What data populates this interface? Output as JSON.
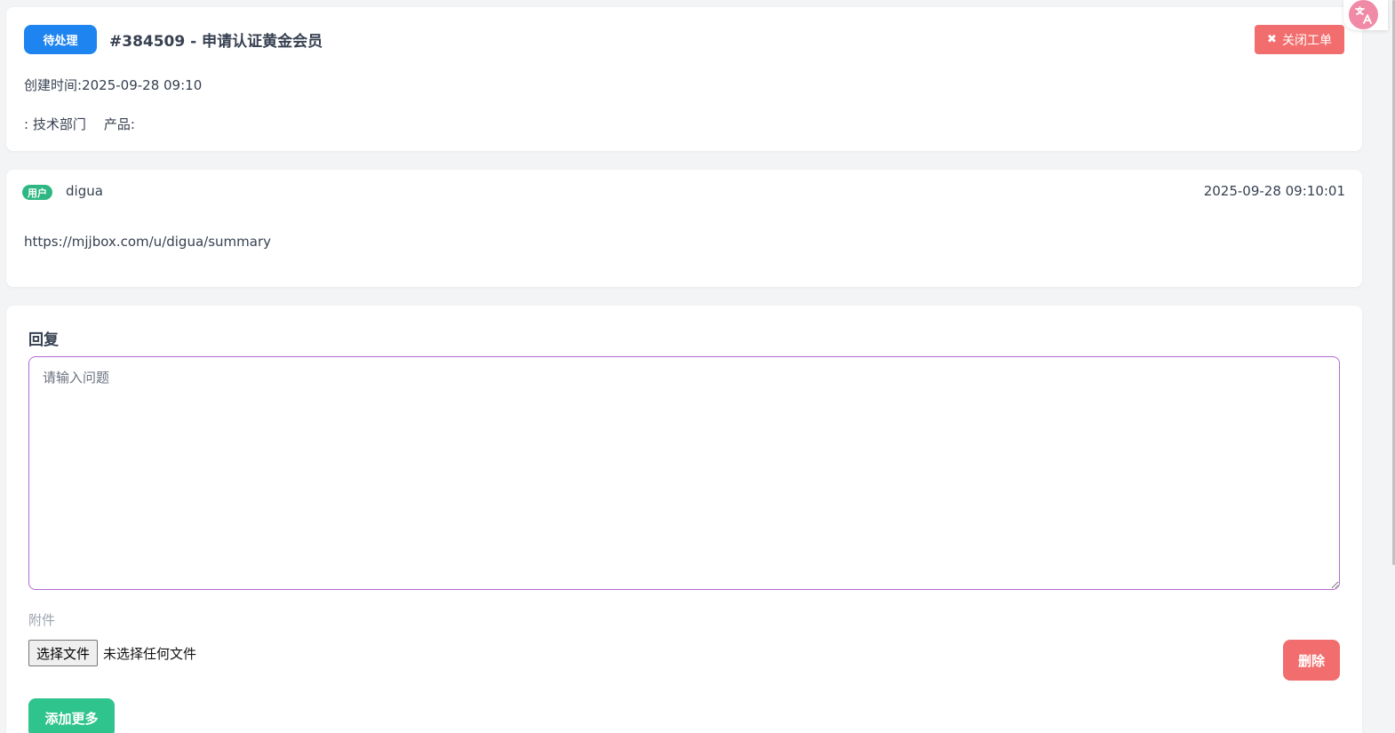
{
  "ticket": {
    "status": "待处理",
    "title": "#384509 - 申请认证黄金会员",
    "close_button": "关闭工单",
    "created_label": "创建时间:",
    "created_value": "2025-09-28 09:10",
    "department_label": ":",
    "department_value": "技术部门",
    "product_label": "产品:",
    "product_value": ""
  },
  "message": {
    "role_badge": "用户",
    "username": "digua",
    "timestamp": "2025-09-28 09:10:01",
    "content": "https://mjjbox.com/u/digua/summary"
  },
  "reply": {
    "heading": "回复",
    "placeholder": "请输入问题",
    "value": "",
    "attachment_label": "附件",
    "choose_file_button": "选择文件",
    "no_file_text": "未选择任何文件",
    "delete_button": "删除",
    "add_more_button": "添加更多"
  },
  "icons": {
    "close": "close-icon",
    "translate": "translate-icon"
  },
  "colors": {
    "status_badge": "#1d84f0",
    "danger": "#f26d6d",
    "success": "#2fc48d",
    "role_badge": "#2fb783",
    "textarea_border": "#b06ad2",
    "translate_widget": "#f08aa6"
  }
}
